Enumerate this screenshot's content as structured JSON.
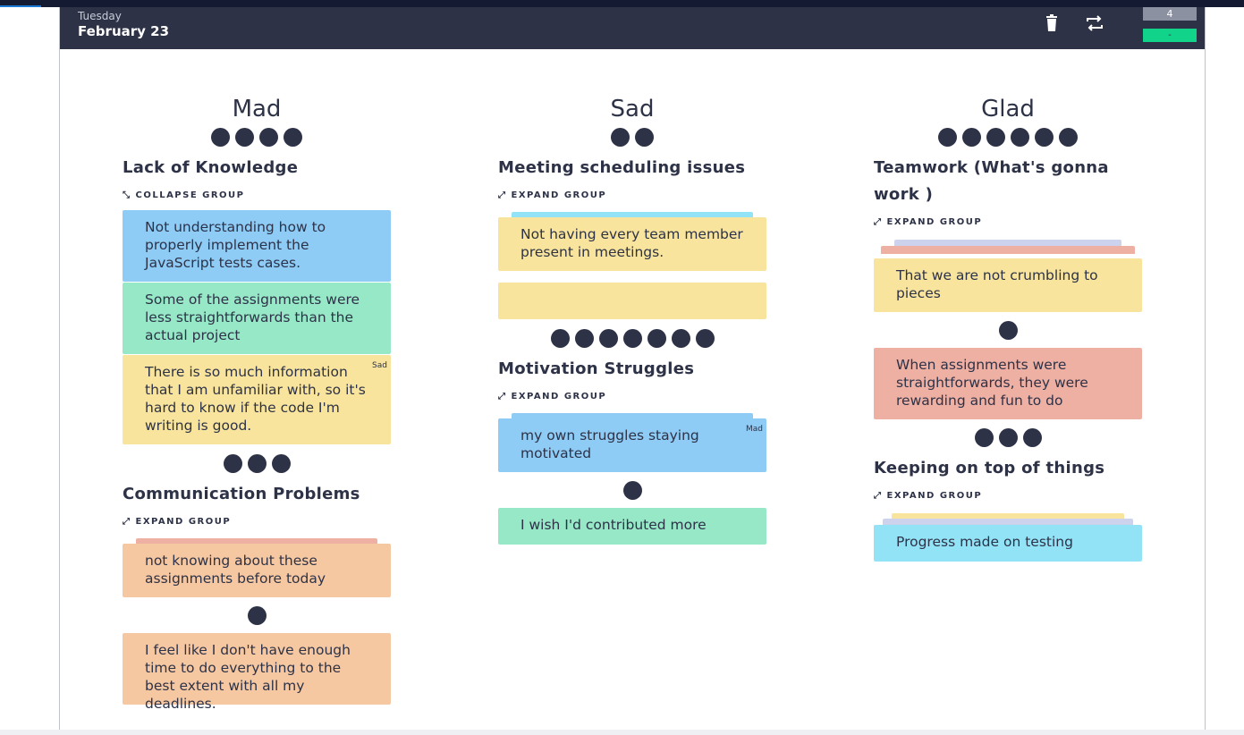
{
  "header": {
    "weekday": "Tuesday",
    "date": "February 23",
    "counter": "4",
    "progress_label": "-",
    "delete_icon": "trash-icon",
    "repeat_icon": "repeat-icon"
  },
  "columns": [
    {
      "title": "Mad",
      "votes": 4,
      "groups": [
        {
          "title": "Lack of Knowledge",
          "toggle": "COLLAPSE GROUP",
          "cards": [
            {
              "text": "Not understanding how to properly implement the JavaScript tests cases.",
              "color": "#8ecbf5"
            },
            {
              "text": "Some of the assignments were less straightforwards than the actual project",
              "color": "#96e8c7"
            },
            {
              "text": "There is so much information that I am unfamiliar with, so it's hard to know if the code I'm writing is good.",
              "color": "#f8e49c",
              "tag": "Sad"
            }
          ],
          "votes_after": 3
        },
        {
          "title": "Communication Problems",
          "toggle": "EXPAND GROUP",
          "cards": [
            {
              "text": "not knowing about these assignments before today",
              "color": "#f6c8a2"
            }
          ],
          "votes_after": 1
        }
      ],
      "loose_cards": [
        {
          "text": "I feel like I don't have enough time to do everything to the best extent with all my deadlines.",
          "color": "#f6c8a2"
        }
      ]
    },
    {
      "title": "Sad",
      "votes": 2,
      "groups": [
        {
          "title": "Meeting scheduling issues",
          "toggle": "EXPAND GROUP",
          "cards": [
            {
              "text": "Not having every team member present in meetings.",
              "color": "#f8e49c"
            }
          ],
          "empty_card_color": "#f8e49c",
          "votes_after": 7
        },
        {
          "title": "Motivation Struggles",
          "toggle": "EXPAND GROUP",
          "cards": [
            {
              "text": "my own struggles staying motivated",
              "color": "#8ecbf5",
              "tag": "Mad"
            }
          ],
          "votes_after": 1
        }
      ],
      "loose_cards": [
        {
          "text": "I wish I'd contributed more",
          "color": "#96e8c7"
        }
      ]
    },
    {
      "title": "Glad",
      "votes": 6,
      "groups": [
        {
          "title": "Teamwork (What's gonna work )",
          "toggle": "EXPAND GROUP",
          "cards": [
            {
              "text": "That we are not crumbling to pieces",
              "color": "#f8e49c"
            }
          ],
          "votes_after": 1
        },
        {
          "title": "Keeping on top of things",
          "toggle": "EXPAND GROUP",
          "cards": [
            {
              "text": "Progress made on testing",
              "color": "#93e3f7"
            }
          ]
        }
      ],
      "loose_cards": [
        {
          "text": "When assignments were straightforwards, they were rewarding and fun to do",
          "color": "#efb0a4",
          "votes_after": 3
        }
      ]
    }
  ]
}
